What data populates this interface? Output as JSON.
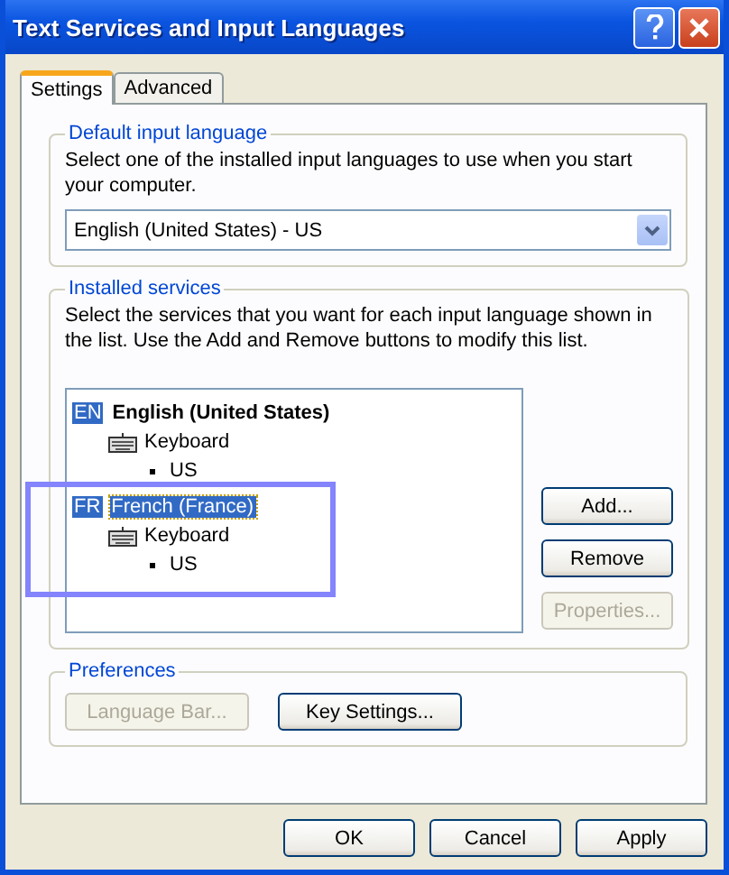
{
  "window": {
    "title": "Text Services and Input Languages"
  },
  "tabs": [
    {
      "label": "Settings",
      "selected": true
    },
    {
      "label": "Advanced",
      "selected": false
    }
  ],
  "default_language": {
    "legend": "Default input language",
    "description": "Select one of the installed input languages to use when you start your computer.",
    "value": "English (United States) - US"
  },
  "installed_services": {
    "legend": "Installed services",
    "description": "Select the services that you want for each input language shown in the list. Use the Add and Remove buttons to modify this list.",
    "languages": [
      {
        "code": "EN",
        "name": "English (United States)",
        "selected": false,
        "children": [
          {
            "label": "Keyboard",
            "children": [
              {
                "label": "US"
              }
            ]
          }
        ]
      },
      {
        "code": "FR",
        "name": "French (France)",
        "selected": true,
        "children": [
          {
            "label": "Keyboard",
            "children": [
              {
                "label": "US"
              }
            ]
          }
        ]
      }
    ],
    "buttons": [
      {
        "label": "Add...",
        "disabled": false
      },
      {
        "label": "Remove",
        "disabled": false
      },
      {
        "label": "Properties...",
        "disabled": true
      }
    ]
  },
  "preferences": {
    "legend": "Preferences",
    "buttons": [
      {
        "label": "Language Bar...",
        "disabled": true
      },
      {
        "label": "Key Settings...",
        "disabled": false
      }
    ]
  },
  "footer_buttons": [
    {
      "label": "OK",
      "disabled": false
    },
    {
      "label": "Cancel",
      "disabled": false
    },
    {
      "label": "Apply",
      "disabled": false
    }
  ]
}
